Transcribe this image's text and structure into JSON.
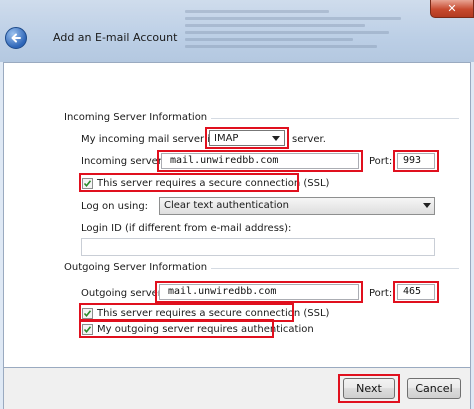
{
  "window": {
    "title": "Add an E-mail Account",
    "close_glyph": "✕"
  },
  "incoming": {
    "section_title": "Incoming Server Information",
    "server_type_prefix": "My incoming mail server is a",
    "server_type_value": "IMAP",
    "server_type_suffix": "server.",
    "server_label": "Incoming server:",
    "server_value": "mail.unwiredbb.com",
    "port_label": "Port:",
    "port_value": "993",
    "ssl_label": "This server requires a secure connection (SSL)",
    "ssl_checked": true,
    "logon_label": "Log on using:",
    "logon_value": "Clear text authentication",
    "login_id_label": "Login ID (if different from e-mail address):",
    "login_id_value": ""
  },
  "outgoing": {
    "section_title": "Outgoing Server Information",
    "server_label": "Outgoing server:",
    "server_value": "mail.unwiredbb.com",
    "port_label": "Port:",
    "port_value": "465",
    "ssl_label": "This server requires a secure connection (SSL)",
    "ssl_checked": true,
    "auth_label": "My outgoing server requires authentication",
    "auth_checked": true
  },
  "buttons": {
    "next": "Next",
    "cancel": "Cancel"
  },
  "colors": {
    "highlight": "#e0101e",
    "back_button": "#2d65b8"
  },
  "icons": {
    "back": "back-arrow-icon",
    "close": "close-icon",
    "check": "checkmark-icon",
    "dropdown": "chevron-down-icon"
  }
}
